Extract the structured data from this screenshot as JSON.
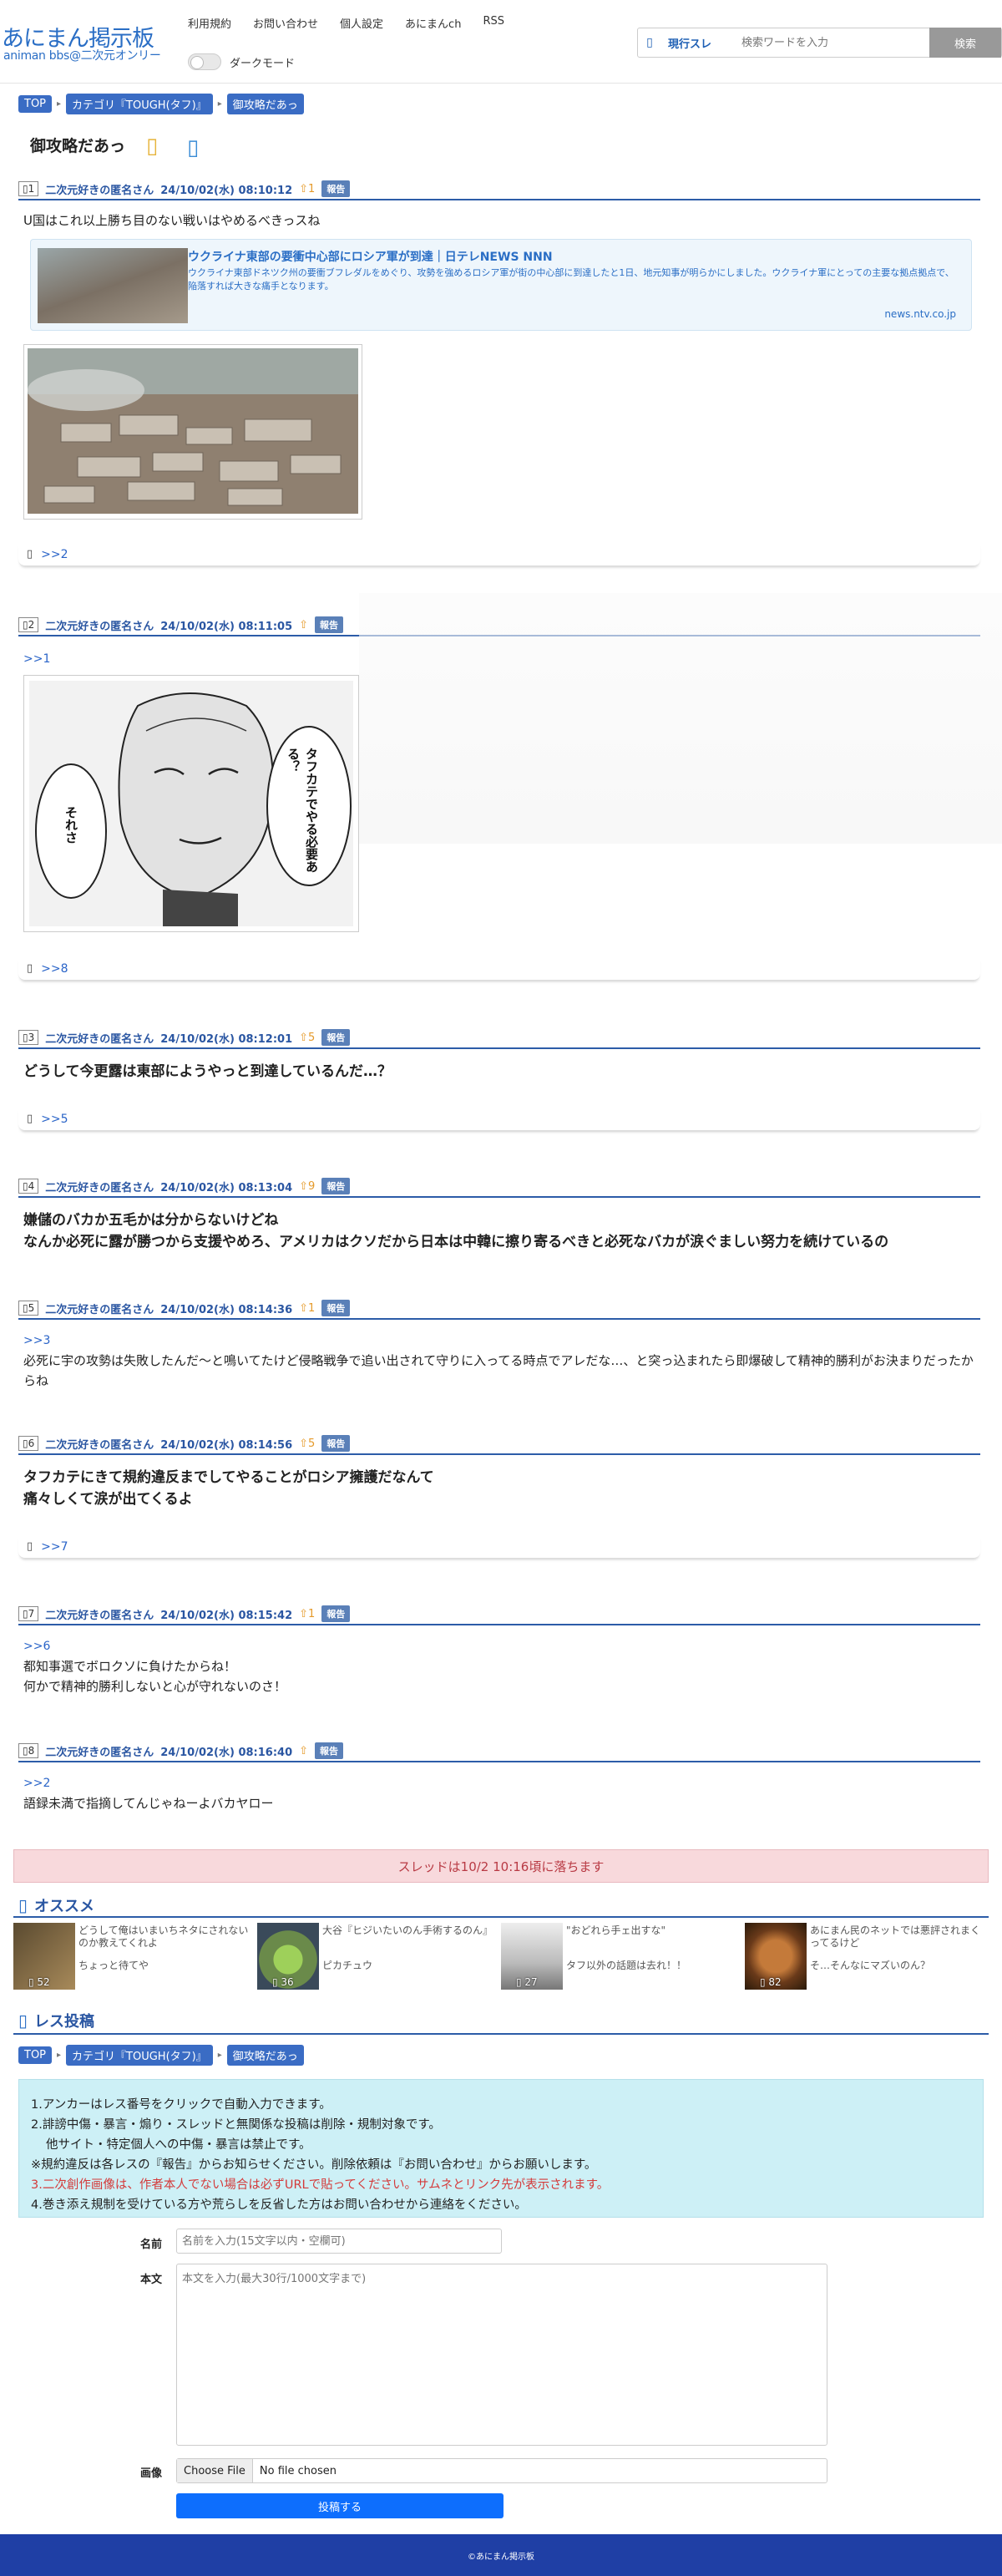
{
  "header": {
    "logo_title": "あにまん掲示板",
    "logo_sub": "animan bbs@二次元オンリー",
    "nav": [
      "利用規約",
      "お問い合わせ",
      "個人設定",
      "あにまんch",
      "RSS"
    ],
    "darkmode_label": "ダークモード",
    "search_scope": "現行スレ",
    "search_placeholder": "検索ワードを入力",
    "search_button": "検索"
  },
  "breadcrumb": [
    "TOP",
    "カテゴリ『TOUGH(タフ)』",
    "御攻略だあっ"
  ],
  "thread_title": "御攻略だあっ",
  "report_label": "報告",
  "posts": [
    {
      "num": "1",
      "name": "二次元好きの匿名さん",
      "date": "24/10/02(水) 08:10:12",
      "votes": "1",
      "body": "U国はこれ以上勝ち目のない戦いはやめるべきっスね",
      "reply": ">>2"
    },
    {
      "num": "2",
      "name": "二次元好きの匿名さん",
      "date": "24/10/02(水) 08:11:05",
      "votes": "",
      "anchor": ">>1",
      "reply": ">>8"
    },
    {
      "num": "3",
      "name": "二次元好きの匿名さん",
      "date": "24/10/02(水) 08:12:01",
      "votes": "5",
      "body": "どうして今更露は東部にようやっと到達しているんだ…？",
      "reply": ">>5"
    },
    {
      "num": "4",
      "name": "二次元好きの匿名さん",
      "date": "24/10/02(水) 08:13:04",
      "votes": "9",
      "body1": "嫌儲のバカか五毛かは分からないけどね",
      "body2": "なんか必死に露が勝つから支援やめろ、アメリカはクソだから日本は中韓に擦り寄るべきと必死なバカが涙ぐましい努力を続けているの"
    },
    {
      "num": "5",
      "name": "二次元好きの匿名さん",
      "date": "24/10/02(水) 08:14:36",
      "votes": "1",
      "anchor": ">>3",
      "body": "必死に宇の攻勢は失敗したんだ〜と鳴いてたけど侵略戦争で追い出されて守りに入ってる時点でアレだな…、と突っ込まれたら即爆破して精神的勝利がお決まりだったからね"
    },
    {
      "num": "6",
      "name": "二次元好きの匿名さん",
      "date": "24/10/02(水) 08:14:56",
      "votes": "5",
      "body1": "タフカテにきて規約違反までしてやることがロシア擁護だなんて",
      "body2": "痛々しくて涙が出てくるよ",
      "reply": ">>7"
    },
    {
      "num": "7",
      "name": "二次元好きの匿名さん",
      "date": "24/10/02(水) 08:15:42",
      "votes": "1",
      "anchor": ">>6",
      "body1": "都知事選でボロクソに負けたからね！",
      "body2": "何かで精神的勝利しないと心が守れないのさ！"
    },
    {
      "num": "8",
      "name": "二次元好きの匿名さん",
      "date": "24/10/02(水) 08:16:40",
      "votes": "",
      "anchor": ">>2",
      "body": "語録未満で指摘してんじゃねーよバカヤロー"
    }
  ],
  "link_card": {
    "title": "ウクライナ東部の要衝中心部にロシア軍が到達｜日テレNEWS NNN",
    "desc": "ウクライナ東部ドネツク州の要衝ブフレダルをめぐり、攻勢を強めるロシア軍が街の中心部に到達したと1日、地元知事が明らかにしました。ウクライナ軍にとっての主要な拠点拠点で、陥落すれば大きな痛手となります。",
    "domain": "news.ntv.co.jp"
  },
  "manga": {
    "speech_left": "それさ",
    "speech_right": "タフカテでやる必要ある？"
  },
  "fall_notice": "スレッドは10/2 10:16頃に落ちます",
  "recommend": {
    "title": "オススメ",
    "items": [
      {
        "title": "どうして俺はいまいちネタにされないのか教えてくれよ",
        "sub": "ちょっと待てや",
        "count": "52",
        "color": "#8a6a3a"
      },
      {
        "title": "大谷『ヒジいたいのん手術するのん』",
        "sub": "ピカチュウ",
        "count": "36",
        "color": "#6aa64a"
      },
      {
        "title": "\"おどれら手ェ出すな\"",
        "sub": "タフ以外の話題は去れ！！",
        "count": "27",
        "color": "#d8d0d0"
      },
      {
        "title": "あにまん民のネットでは悪評されまくってるけど",
        "sub": "そ…そんなにマズいのん？",
        "count": "82",
        "color": "#8b5a2a"
      }
    ]
  },
  "post_form": {
    "title": "レス投稿",
    "rules": {
      "r1": "1.アンカーはレス番号をクリックで自動入力できます。",
      "r2": "2.誹謗中傷・暴言・煽り・スレッドと無関係な投稿は削除・規制対象です。",
      "r2b": "他サイト・特定個人への中傷・暴言は禁止です。",
      "r_note": "※規約違反は各レスの『報告』からお知らせください。削除依頼は『お問い合わせ』からお願いします。",
      "r3": "3.二次創作画像は、作者本人でない場合は必ずURLで貼ってください。サムネとリンク先が表示されます。",
      "r4": "4.巻き添え規制を受けている方や荒らしを反省した方はお問い合わせから連絡をください。"
    },
    "name_label": "名前",
    "name_placeholder": "名前を入力(15文字以内・空欄可)",
    "body_label": "本文",
    "body_placeholder": "本文を入力(最大30行/1000文字まで)",
    "image_label": "画像",
    "file_button": "Choose File",
    "file_status": "No file chosen",
    "submit": "投稿する"
  },
  "footer": "©あにまん掲示板"
}
